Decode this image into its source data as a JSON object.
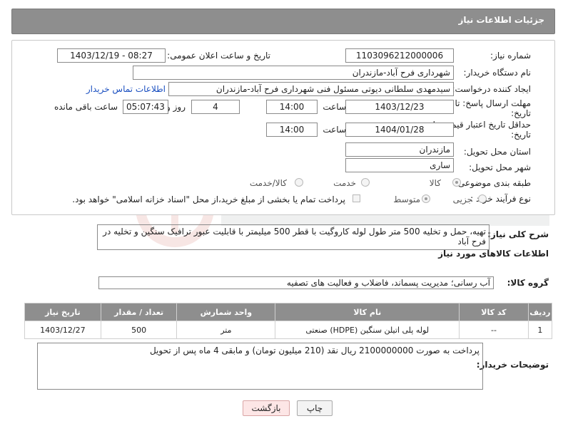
{
  "header": {
    "title": "جزئیات اطلاعات نیاز"
  },
  "fields": {
    "need_number_label": "شماره نیاز:",
    "need_number": "1103096212000006",
    "announce_label": "تاریخ و ساعت اعلان عمومی:",
    "announce_value": "1403/12/19 - 08:27",
    "buyer_org_label": "نام دستگاه خریدار:",
    "buyer_org": "شهرداری فرح آباد-مازندران",
    "creator_label": "ایجاد کننده درخواست:",
    "creator": "سیدمهدی سلطانی دیوتی مسئول فنی شهرداری فرح آباد-مازندران",
    "contact_link": "اطلاعات تماس خریدار",
    "deadline_label": "مهلت ارسال پاسخ: تا",
    "deadline_label2": "تاریخ:",
    "deadline_date": "1403/12/23",
    "time_label": "ساعت",
    "deadline_time": "14:00",
    "days_value": "4",
    "days_label": "روز و",
    "remaining_time": "05:07:43",
    "remaining_label": "ساعت باقی مانده",
    "validity_label": "حداقل تاریخ اعتبار قیمت: تا",
    "validity_label2": "تاریخ:",
    "validity_date": "1404/01/28",
    "validity_time": "14:00",
    "province_label": "استان محل تحویل:",
    "province": "مازندران",
    "city_label": "شهر محل تحویل:",
    "city": "ساری",
    "category_label": "طبقه بندی موضوعی:",
    "category_options": [
      "کالا",
      "خدمت",
      "کالا/خدمت"
    ],
    "process_label": "نوع فرآیند خرید :",
    "process_options": [
      "جزیی",
      "متوسط"
    ],
    "payment_note": "پرداخت تمام یا بخشی از مبلغ خرید،از محل \"اسناد خزانه اسلامی\" خواهد بود."
  },
  "description": {
    "label": "شرح کلی نیاز:",
    "text": "تهیه، حمل و تخلیه 500 متر طول لوله کاروگیت با قطر 500 میلیمتر  با قابلیت عبور ترافیک سنگین و تخلیه در فرح آباد"
  },
  "goods": {
    "section_title": "اطلاعات کالاهای مورد نیاز",
    "group_label": "گروه کالا:",
    "group_value": "آب رسانی؛ مدیریت پسماند، فاضلاب و فعالیت های تصفیه",
    "columns": [
      "ردیف",
      "کد کالا",
      "نام کالا",
      "واحد شمارش",
      "تعداد / مقدار",
      "تاریخ نیاز"
    ],
    "rows": [
      [
        "1",
        "--",
        "لوله پلی اتیلن سنگین (HDPE) صنعتی",
        "متر",
        "500",
        "1403/12/27"
      ]
    ]
  },
  "buyer_notes": {
    "label": "توضیحات خریدار:",
    "text": "پرداخت به صورت 2100000000 ریال نقد (210 میلیون تومان) و مابقی 4 ماه پس از تحویل"
  },
  "buttons": {
    "print": "چاپ",
    "back": "بازگشت"
  },
  "colors": {
    "header_bg": "#8e8e8e",
    "link": "#1a4fc0",
    "back_button_bg": "#fde6e6"
  }
}
